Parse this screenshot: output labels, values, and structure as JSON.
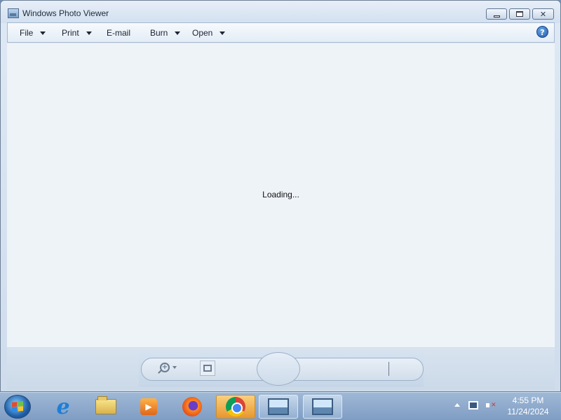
{
  "window": {
    "title": "Windows Photo Viewer",
    "minimize_icon": "minimize-icon",
    "maximize_icon": "maximize-icon",
    "close_icon": "close-icon"
  },
  "menu": {
    "items": [
      {
        "label": "File",
        "has_dropdown": true
      },
      {
        "label": "Print",
        "has_dropdown": true
      },
      {
        "label": "E-mail",
        "has_dropdown": false
      },
      {
        "label": "Burn",
        "has_dropdown": true
      },
      {
        "label": "Open",
        "has_dropdown": true
      }
    ],
    "help_label": "?"
  },
  "content": {
    "status_text": "Loading..."
  },
  "controls": {
    "zoom_icon": "zoom-in-icon",
    "fit_icon": "actual-size-icon"
  },
  "taskbar": {
    "apps": [
      "start",
      "internet-explorer",
      "file-explorer",
      "media-player",
      "firefox",
      "chrome",
      "photo-viewer",
      "photo-viewer"
    ],
    "clock_time": "4:55 PM",
    "clock_date": "11/24/2024"
  },
  "colors": {
    "content_bg": "#eef3f8",
    "taskbar_bg": "#8fabcd",
    "highlight": "#e8962e"
  }
}
